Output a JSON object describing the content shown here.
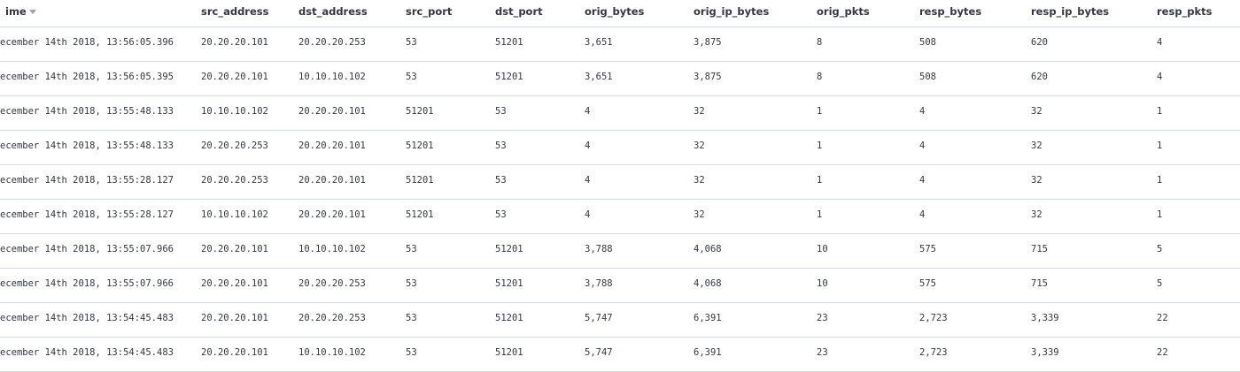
{
  "columns": {
    "time": "ime",
    "src_address": "src_address",
    "dst_address": "dst_address",
    "src_port": "src_port",
    "dst_port": "dst_port",
    "orig_bytes": "orig_bytes",
    "orig_ip_bytes": "orig_ip_bytes",
    "orig_pkts": "orig_pkts",
    "resp_bytes": "resp_bytes",
    "resp_ip_bytes": "resp_ip_bytes",
    "resp_pkts": "resp_pkts"
  },
  "sort_icon": "sort-down-icon",
  "rows": [
    {
      "time": "ecember 14th 2018, 13:56:05.396",
      "src_address": "20.20.20.101",
      "dst_address": "20.20.20.253",
      "src_port": "53",
      "dst_port": "51201",
      "orig_bytes": "3,651",
      "orig_ip_bytes": "3,875",
      "orig_pkts": "8",
      "resp_bytes": "508",
      "resp_ip_bytes": "620",
      "resp_pkts": "4"
    },
    {
      "time": "ecember 14th 2018, 13:56:05.395",
      "src_address": "20.20.20.101",
      "dst_address": "10.10.10.102",
      "src_port": "53",
      "dst_port": "51201",
      "orig_bytes": "3,651",
      "orig_ip_bytes": "3,875",
      "orig_pkts": "8",
      "resp_bytes": "508",
      "resp_ip_bytes": "620",
      "resp_pkts": "4"
    },
    {
      "time": "ecember 14th 2018, 13:55:48.133",
      "src_address": "10.10.10.102",
      "dst_address": "20.20.20.101",
      "src_port": "51201",
      "dst_port": "53",
      "orig_bytes": "4",
      "orig_ip_bytes": "32",
      "orig_pkts": "1",
      "resp_bytes": "4",
      "resp_ip_bytes": "32",
      "resp_pkts": "1"
    },
    {
      "time": "ecember 14th 2018, 13:55:48.133",
      "src_address": "20.20.20.253",
      "dst_address": "20.20.20.101",
      "src_port": "51201",
      "dst_port": "53",
      "orig_bytes": "4",
      "orig_ip_bytes": "32",
      "orig_pkts": "1",
      "resp_bytes": "4",
      "resp_ip_bytes": "32",
      "resp_pkts": "1"
    },
    {
      "time": "ecember 14th 2018, 13:55:28.127",
      "src_address": "20.20.20.253",
      "dst_address": "20.20.20.101",
      "src_port": "51201",
      "dst_port": "53",
      "orig_bytes": "4",
      "orig_ip_bytes": "32",
      "orig_pkts": "1",
      "resp_bytes": "4",
      "resp_ip_bytes": "32",
      "resp_pkts": "1"
    },
    {
      "time": "ecember 14th 2018, 13:55:28.127",
      "src_address": "10.10.10.102",
      "dst_address": "20.20.20.101",
      "src_port": "51201",
      "dst_port": "53",
      "orig_bytes": "4",
      "orig_ip_bytes": "32",
      "orig_pkts": "1",
      "resp_bytes": "4",
      "resp_ip_bytes": "32",
      "resp_pkts": "1"
    },
    {
      "time": "ecember 14th 2018, 13:55:07.966",
      "src_address": "20.20.20.101",
      "dst_address": "10.10.10.102",
      "src_port": "53",
      "dst_port": "51201",
      "orig_bytes": "3,788",
      "orig_ip_bytes": "4,068",
      "orig_pkts": "10",
      "resp_bytes": "575",
      "resp_ip_bytes": "715",
      "resp_pkts": "5"
    },
    {
      "time": "ecember 14th 2018, 13:55:07.966",
      "src_address": "20.20.20.101",
      "dst_address": "20.20.20.253",
      "src_port": "53",
      "dst_port": "51201",
      "orig_bytes": "3,788",
      "orig_ip_bytes": "4,068",
      "orig_pkts": "10",
      "resp_bytes": "575",
      "resp_ip_bytes": "715",
      "resp_pkts": "5"
    },
    {
      "time": "ecember 14th 2018, 13:54:45.483",
      "src_address": "20.20.20.101",
      "dst_address": "20.20.20.253",
      "src_port": "53",
      "dst_port": "51201",
      "orig_bytes": "5,747",
      "orig_ip_bytes": "6,391",
      "orig_pkts": "23",
      "resp_bytes": "2,723",
      "resp_ip_bytes": "3,339",
      "resp_pkts": "22"
    },
    {
      "time": "ecember 14th 2018, 13:54:45.483",
      "src_address": "20.20.20.101",
      "dst_address": "10.10.10.102",
      "src_port": "53",
      "dst_port": "51201",
      "orig_bytes": "5,747",
      "orig_ip_bytes": "6,391",
      "orig_pkts": "23",
      "resp_bytes": "2,723",
      "resp_ip_bytes": "3,339",
      "resp_pkts": "22"
    }
  ]
}
